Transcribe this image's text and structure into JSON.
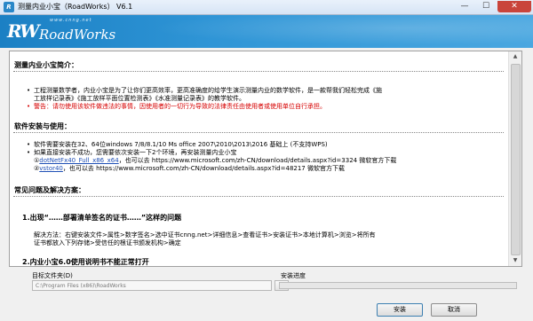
{
  "window": {
    "title": "测量内业小宝（RoadWorks） V6.1",
    "min_glyph": "—",
    "max_glyph": "☐",
    "close_glyph": "✕",
    "app_icon_text": "R"
  },
  "banner": {
    "logo_mark": "RW",
    "site": "www.cnng.net",
    "name": "RoadWorks"
  },
  "content": {
    "intro_heading": "测量内业小宝简介：",
    "intro_lines": [
      "工程测量数学者，内业小宝是为了让你们更高效率，更高准确度的给学生演示测量内业的数学软件，是一款帮我们轻松完成《施",
      "工放样记录表》《施工放样平面位置检测表》《水准测量记录表》的教学软件。"
    ],
    "warning": "警告：请勿使用该软件做违法的事情，因使用者的一切行为导致的法律责任由使用者或使用单位自行承担。",
    "install_heading": "软件安装与使用：",
    "install_line1": "软件需要安装在32、64位windows 7/8/8.1/10 Ms office 2007\\2010\\2013\\2016 基础上 (不支持WPS)",
    "install_line2": "如果直接安装不成功，您需要依次安装一下2个环境，再安装测量内业小宝",
    "install_item1_num": "①",
    "install_item1_link": "dotNetFx40_Full_x86_x64",
    "install_item1_rest": "，也可以去 https://www.microsoft.com/zh-CN/download/details.aspx?id=3324 微软官方下载",
    "install_item2_num": "②",
    "install_item2_link": "vstor40",
    "install_item2_rest": "，也可以去 https://www.microsoft.com/zh-CN/download/details.aspx?id=48217 微软官方下载",
    "faq_heading": "常见问题及解决方案：",
    "faq1_title": "1.出现“……部署清单签名的证书……”这样的问题",
    "faq1_lines": [
      "解决方法：右键安装文件>属性>数字签名>选中证书cnng.net>详细信息>查看证书>安装证书>本地计算机>浏览>将所有",
      "证书都放入下列存储>受信任的根证书颁发机构>确定"
    ],
    "faq2_title": "2.内业小宝6.0使用说明书不能正常打开"
  },
  "scrollbar": {
    "up": "▲",
    "down": "▼"
  },
  "bottom": {
    "target_label": "目标文件夹(D)",
    "target_path": "C:\\Program Files (x86)\\RoadWorks",
    "browse_label": "...",
    "progress_label": "安装进度",
    "progress_fraction": 0.0,
    "install_button": "安装",
    "cancel_button": "取消"
  },
  "colors": {
    "banner_blue": "#1b80c4",
    "warning_red": "#d60000",
    "link_blue": "#1f4fb5"
  }
}
